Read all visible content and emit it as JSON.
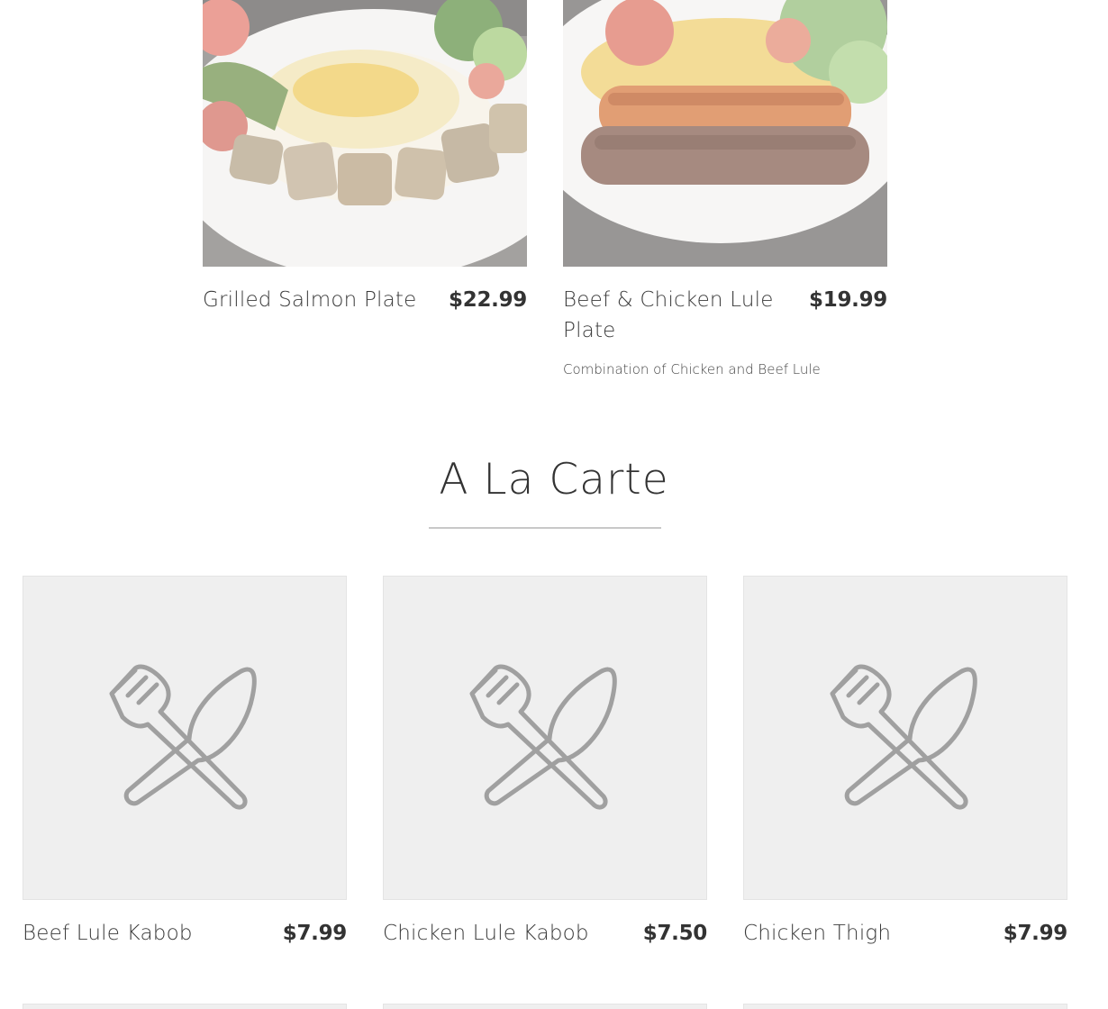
{
  "featured_items": [
    {
      "name": "Grilled Salmon Plate",
      "price": "$22.99",
      "description": ""
    },
    {
      "name": "Beef & Chicken Lule Plate",
      "price": "$19.99",
      "description": "Combination of Chicken and Beef Lule"
    }
  ],
  "section": {
    "title": "A La Carte"
  },
  "items": [
    {
      "name": "Beef Lule Kabob",
      "price": "$7.99",
      "image": "fork-knife-placeholder-icon"
    },
    {
      "name": "Chicken Lule Kabob",
      "price": "$7.50",
      "image": "fork-knife-placeholder-icon"
    },
    {
      "name": "Chicken Thigh",
      "price": "$7.99",
      "image": "fork-knife-placeholder-icon"
    }
  ],
  "colors": {
    "text": "#333333",
    "placeholder_bg": "#efefef",
    "placeholder_icon": "#9a9a9a",
    "rule": "#c8c8c8"
  }
}
